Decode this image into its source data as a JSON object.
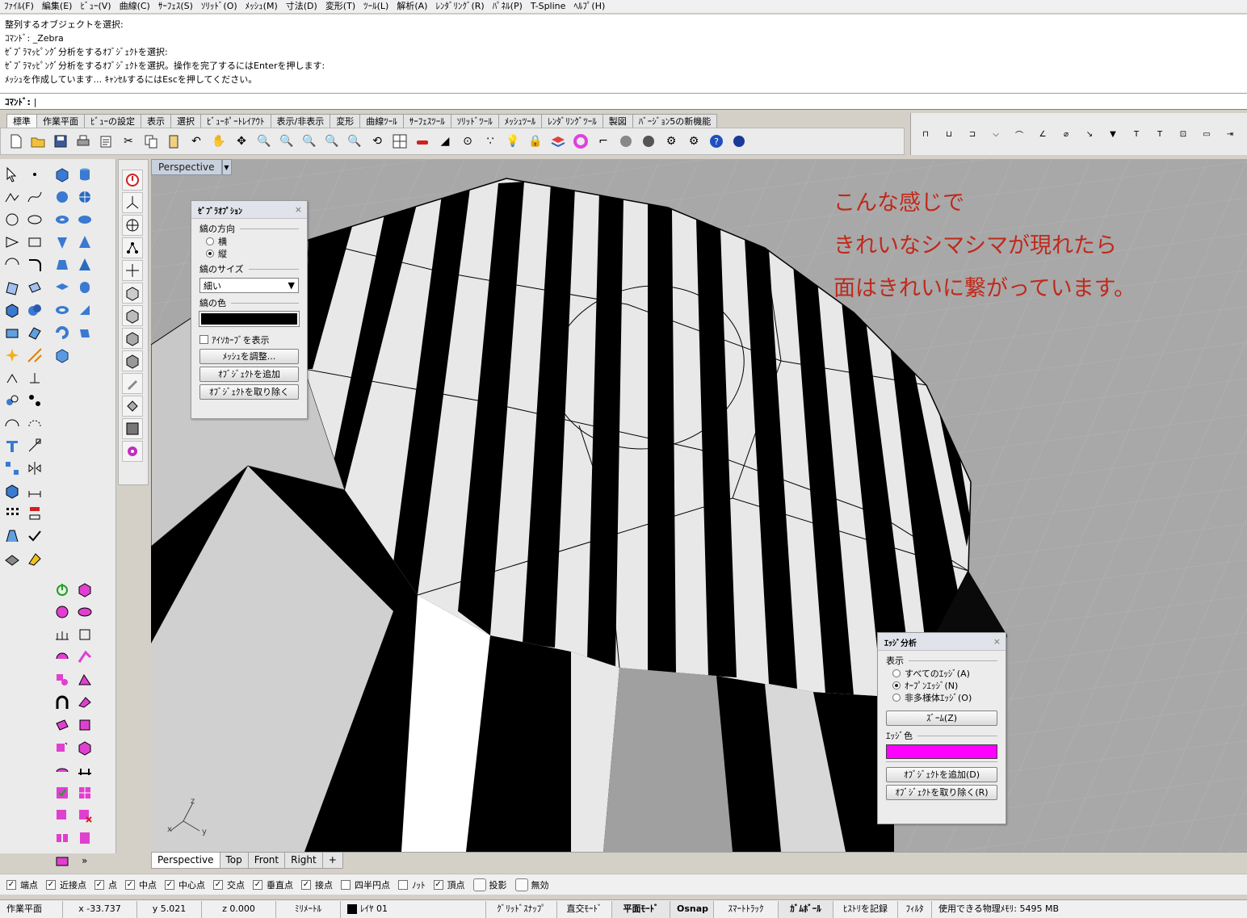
{
  "menu": [
    "ﾌｧｲﾙ(F)",
    "編集(E)",
    "ﾋﾞｭｰ(V)",
    "曲線(C)",
    "ｻｰﾌｪｽ(S)",
    "ｿﾘｯﾄﾞ(O)",
    "ﾒｯｼｭ(M)",
    "寸法(D)",
    "変形(T)",
    "ﾂｰﾙ(L)",
    "解析(A)",
    "ﾚﾝﾀﾞﾘﾝｸﾞ(R)",
    "ﾊﾟﾈﾙ(P)",
    "T-Spline",
    "ﾍﾙﾌﾟ(H)"
  ],
  "history": [
    "整列するオブジェクトを選択:",
    "ｺﾏﾝﾄﾞ: _Zebra",
    "ｾﾞﾌﾞﾗﾏｯﾋﾟﾝｸﾞ分析をするｵﾌﾞｼﾞｪｸﾄを選択:",
    "ｾﾞﾌﾞﾗﾏｯﾋﾟﾝｸﾞ分析をするｵﾌﾞｼﾞｪｸﾄを選択。操作を完了するにはEnterを押します:",
    "ﾒｯｼｭを作成しています... ｷｬﾝｾﾙするにはEscを押してください。"
  ],
  "command": {
    "label": "ｺﾏﾝﾄﾞ:",
    "value": "|"
  },
  "tabs": [
    "標準",
    "作業平面",
    "ﾋﾞｭｰの設定",
    "表示",
    "選択",
    "ﾋﾞｭｰﾎﾟｰﾄﾚｲｱｳﾄ",
    "表示/非表示",
    "変形",
    "曲線ﾂｰﾙ",
    "ｻｰﾌｪｽﾂｰﾙ",
    "ｿﾘｯﾄﾞﾂｰﾙ",
    "ﾒｯｼｭﾂｰﾙ",
    "ﾚﾝﾀﾞﾘﾝｸﾞﾂｰﾙ",
    "製図",
    "ﾊﾞｰｼﾞｮﾝ5の新機能"
  ],
  "viewport": {
    "title": "Perspective"
  },
  "annotation": [
    "こんな感じで",
    "きれいなシマシマが現れたら",
    "面はきれいに繋がっています。"
  ],
  "zebra_panel": {
    "title": "ｾﾞﾌﾞﾗｵﾌﾟｼｮﾝ",
    "direction_label": "縞の方向",
    "opt_horizontal": "横",
    "opt_vertical": "縦",
    "size_label": "縞のサイズ",
    "size_value": "細い",
    "color_label": "縞の色",
    "color": "#000000",
    "isocurve_label": "ｱｲｿｶｰﾌﾞを表示",
    "btn_mesh": "ﾒｯｼｭを調整...",
    "btn_add": "ｵﾌﾞｼﾞｪｸﾄを追加",
    "btn_remove": "ｵﾌﾞｼﾞｪｸﾄを取り除く"
  },
  "edge_panel": {
    "title": "ｴｯｼﾞ分析",
    "show_label": "表示",
    "opt_all": "すべてのｴｯｼﾞ(A)",
    "opt_open": "ｵｰﾌﾟﾝｴｯｼﾞ(N)",
    "opt_nonmanifold": "非多様体ｴｯｼﾞ(O)",
    "btn_zoom": "ｽﾞｰﾑ(Z)",
    "color_label": "ｴｯｼﾞ色",
    "color": "#ff00ff",
    "btn_add": "ｵﾌﾞｼﾞｪｸﾄを追加(D)",
    "btn_remove": "ｵﾌﾞｼﾞｪｸﾄを取り除く(R)"
  },
  "axis": {
    "x": "x",
    "y": "y",
    "z": "z"
  },
  "viewport_tabs": [
    "Perspective",
    "Top",
    "Front",
    "Right",
    "+"
  ],
  "osnaps": [
    {
      "label": "端点",
      "on": true
    },
    {
      "label": "近接点",
      "on": true
    },
    {
      "label": "点",
      "on": true
    },
    {
      "label": "中点",
      "on": true
    },
    {
      "label": "中心点",
      "on": true
    },
    {
      "label": "交点",
      "on": true
    },
    {
      "label": "垂直点",
      "on": true
    },
    {
      "label": "接点",
      "on": true
    },
    {
      "label": "四半円点",
      "on": false
    },
    {
      "label": "ﾉｯﾄ",
      "on": false
    },
    {
      "label": "頂点",
      "on": true
    }
  ],
  "osnap_buttons": [
    "投影",
    "無効"
  ],
  "status": {
    "cplane": "作業平面",
    "x": "x -33.737",
    "y": "y 5.021",
    "z": "z 0.000",
    "units": "ﾐﾘﾒｰﾄﾙ",
    "layer": "ﾚｲﾔ 01",
    "grid_snap": "ｸﾞﾘｯﾄﾞｽﾅｯﾌﾟ",
    "ortho": "直交ﾓｰﾄﾞ",
    "planar": "平面ﾓｰﾄﾞ",
    "osnap": "Osnap",
    "smarttrack": "ｽﾏｰﾄﾄﾗｯｸ",
    "gumball": "ｶﾞﾑﾎﾞｰﾙ",
    "history": "ﾋｽﾄﾘを記録",
    "filter": "ﾌｨﾙﾀ",
    "memory": "使用できる物理ﾒﾓﾘ: 5495 MB"
  },
  "colors": {
    "annotation": "#c0291b",
    "edge_color": "#ff00ff",
    "stripe": "#000000"
  }
}
